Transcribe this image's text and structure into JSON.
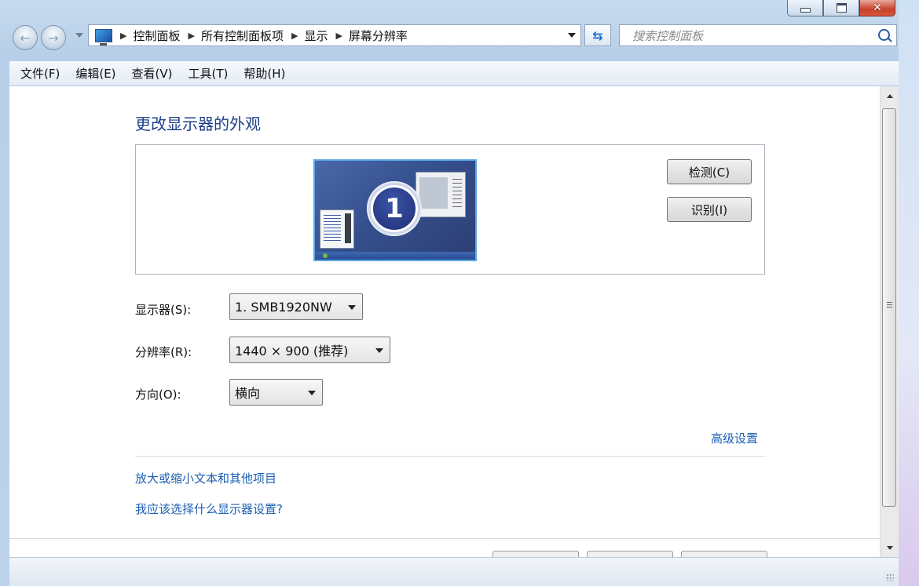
{
  "window": {
    "caption_buttons": [
      "minimize",
      "maximize",
      "close"
    ]
  },
  "navigation": {
    "breadcrumbs": [
      "控制面板",
      "所有控制面板项",
      "显示",
      "屏幕分辨率"
    ],
    "search_placeholder": "搜索控制面板"
  },
  "menu": {
    "items": [
      "文件(F)",
      "编辑(E)",
      "查看(V)",
      "工具(T)",
      "帮助(H)"
    ]
  },
  "main": {
    "title": "更改显示器的外观",
    "monitor_number": "1",
    "detect_label": "检测(C)",
    "identify_label": "识别(I)",
    "display_label": "显示器(S):",
    "display_value": "1. SMB1920NW",
    "resolution_label": "分辨率(R):",
    "resolution_value": "1440 × 900 (推荐)",
    "orientation_label": "方向(O):",
    "orientation_value": "横向",
    "advanced_link": "高级设置",
    "zoom_link": "放大或缩小文本和其他项目",
    "help_link": "我应该选择什么显示器设置?"
  },
  "colors": {
    "link": "#1c5fb5",
    "title": "#1e3e8a",
    "monitor_bg": "#3a5596",
    "monitor_border": "#5aa7e6"
  }
}
